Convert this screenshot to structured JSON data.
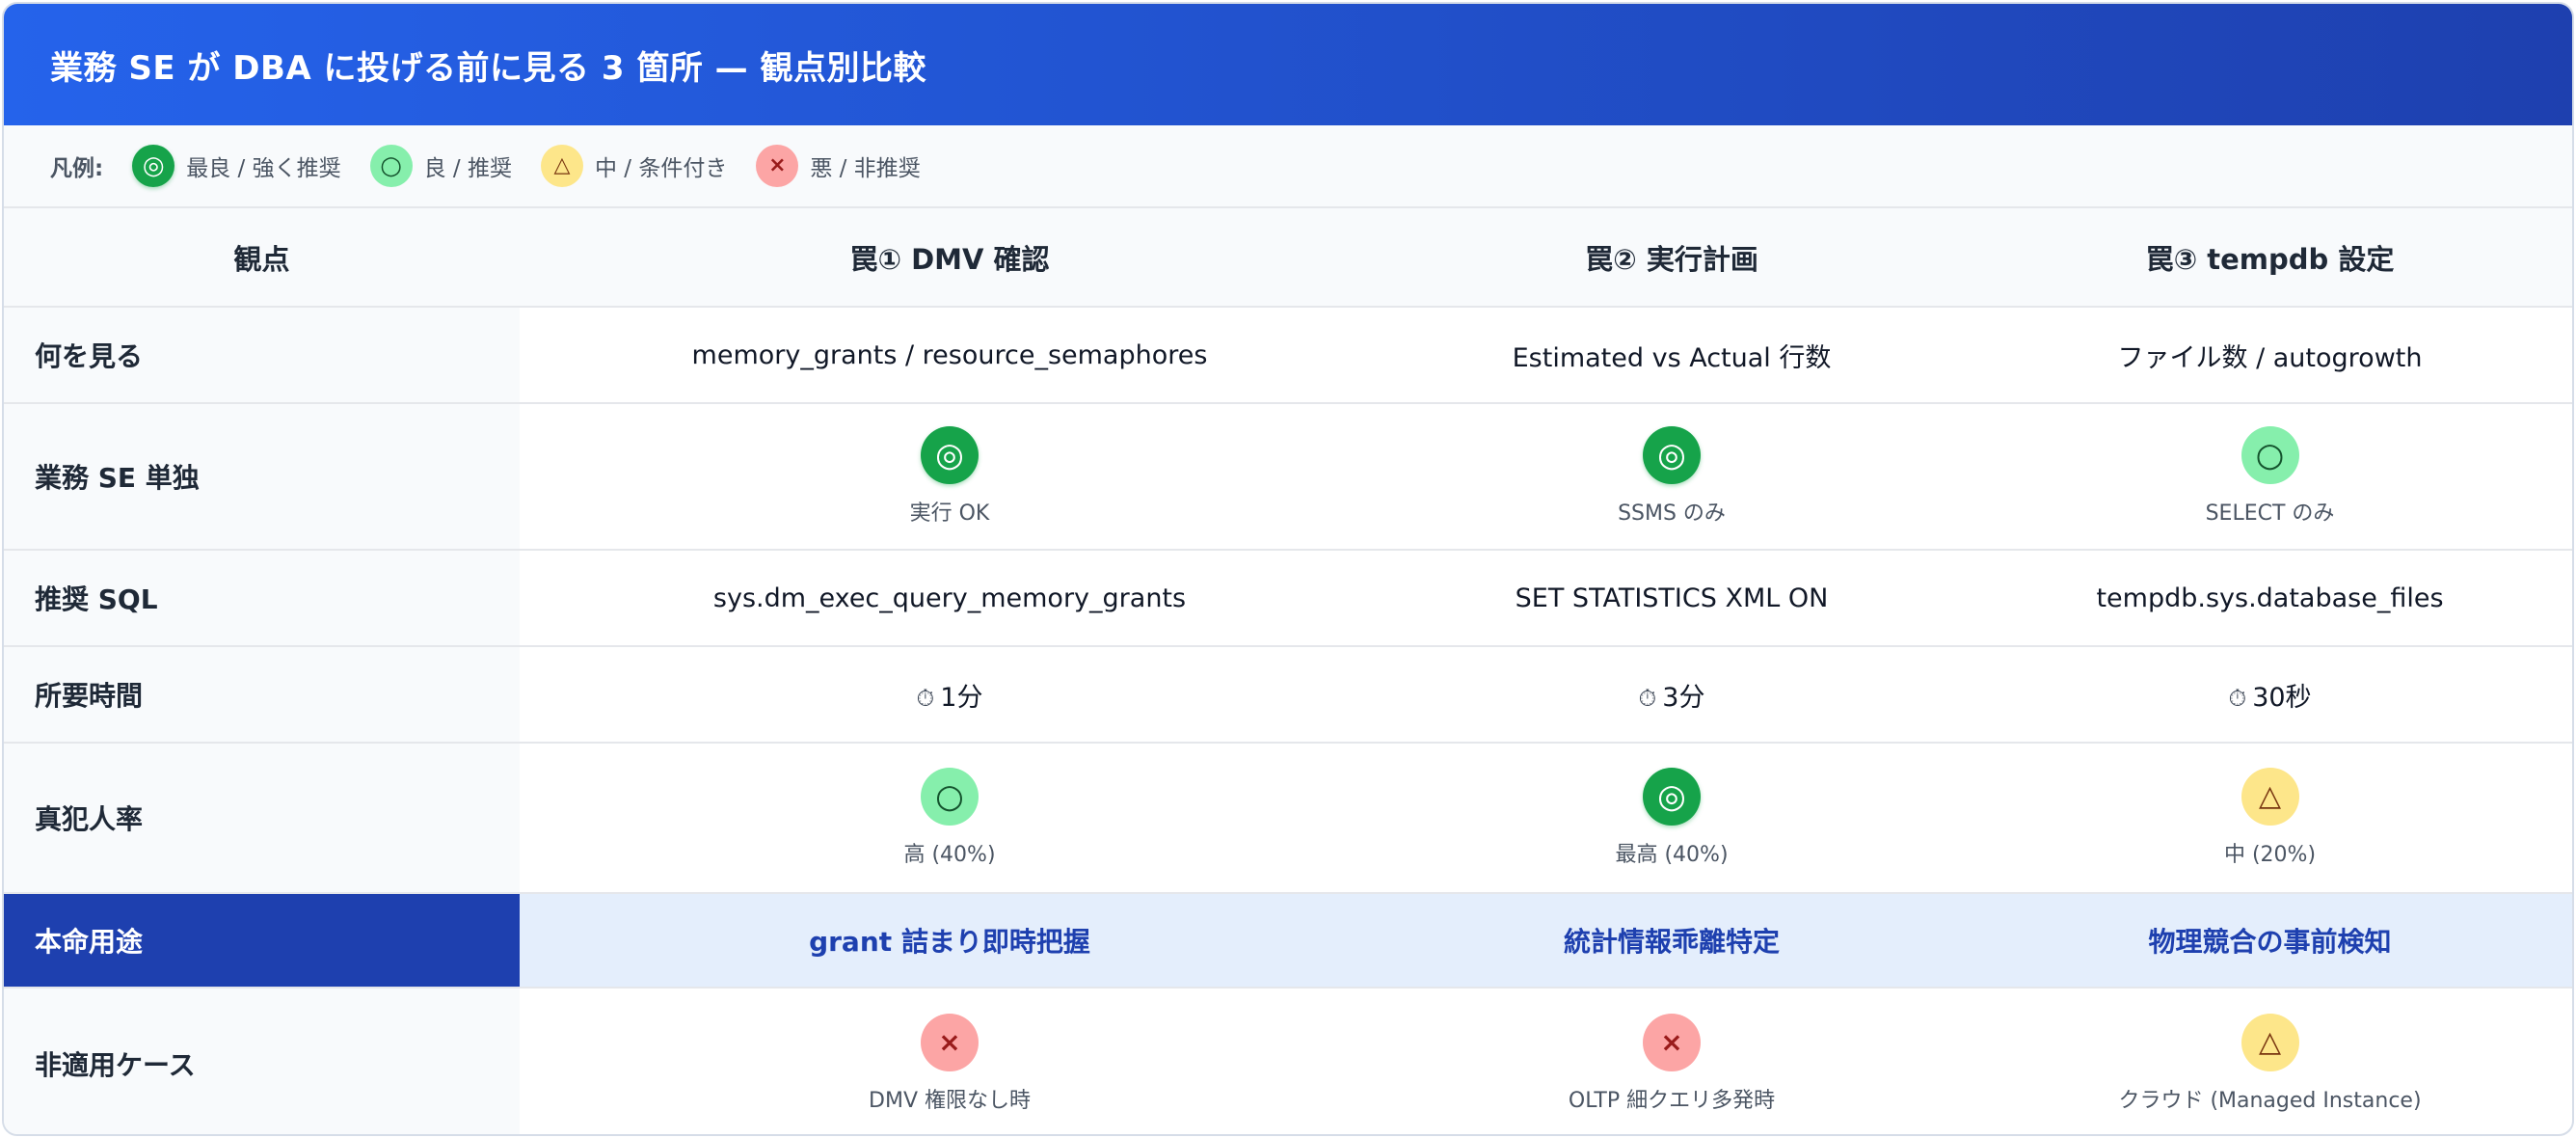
{
  "title": "業務 SE が DBA に投げる前に見る 3 箇所 — 観点別比較",
  "legend": {
    "label": "凡例:",
    "items": [
      {
        "symbol": "◎",
        "level": "best",
        "text": "最良 / 強く推奨"
      },
      {
        "symbol": "○",
        "level": "good",
        "text": "良 / 推奨"
      },
      {
        "symbol": "△",
        "level": "mid",
        "text": "中 / 条件付き"
      },
      {
        "symbol": "×",
        "level": "bad",
        "text": "悪 / 非推奨"
      }
    ]
  },
  "table": {
    "headers": [
      "観点",
      "罠① DMV 確認",
      "罠② 実行計画",
      "罠③ tempdb 設定"
    ],
    "rows": {
      "what": {
        "label": "何を見る",
        "cells": [
          "memory_grants / resource_semaphores",
          "Estimated vs Actual 行数",
          "ファイル数 / autogrowth"
        ]
      },
      "solo": {
        "label": "業務 SE 単独",
        "cells": [
          {
            "symbol": "◎",
            "level": "best",
            "note": "実行 OK"
          },
          {
            "symbol": "◎",
            "level": "best",
            "note": "SSMS のみ"
          },
          {
            "symbol": "○",
            "level": "good",
            "note": "SELECT のみ"
          }
        ]
      },
      "sql": {
        "label": "推奨 SQL",
        "cells": [
          "sys.dm_exec_query_memory_grants",
          "SET STATISTICS XML ON",
          "tempdb.sys.database_files"
        ]
      },
      "time": {
        "label": "所要時間",
        "icon": "⏱",
        "cells": [
          "1分",
          "3分",
          "30秒"
        ]
      },
      "culprit": {
        "label": "真犯人率",
        "cells": [
          {
            "symbol": "○",
            "level": "good",
            "note": "高 (40%)"
          },
          {
            "symbol": "◎",
            "level": "best",
            "note": "最高 (40%)"
          },
          {
            "symbol": "△",
            "level": "mid",
            "note": "中 (20%)"
          }
        ]
      },
      "purpose": {
        "label": "本命用途",
        "cells": [
          "grant 詰まり即時把握",
          "統計情報乖離特定",
          "物理競合の事前検知"
        ]
      },
      "notfit": {
        "label": "非適用ケース",
        "cells": [
          {
            "symbol": "×",
            "level": "bad",
            "note": "DMV 権限なし時"
          },
          {
            "symbol": "×",
            "level": "bad",
            "note": "OLTP 細クエリ多発時"
          },
          {
            "symbol": "△",
            "level": "mid",
            "note": "クラウド (Managed Instance)"
          }
        ]
      }
    }
  },
  "colors": {
    "header_start": "#2563eb",
    "header_end": "#1e40af",
    "best": "#16a34a",
    "good": "#86efac",
    "mid": "#fde68a",
    "bad": "#fca5a5",
    "highlight_row": "#e4eefc"
  }
}
